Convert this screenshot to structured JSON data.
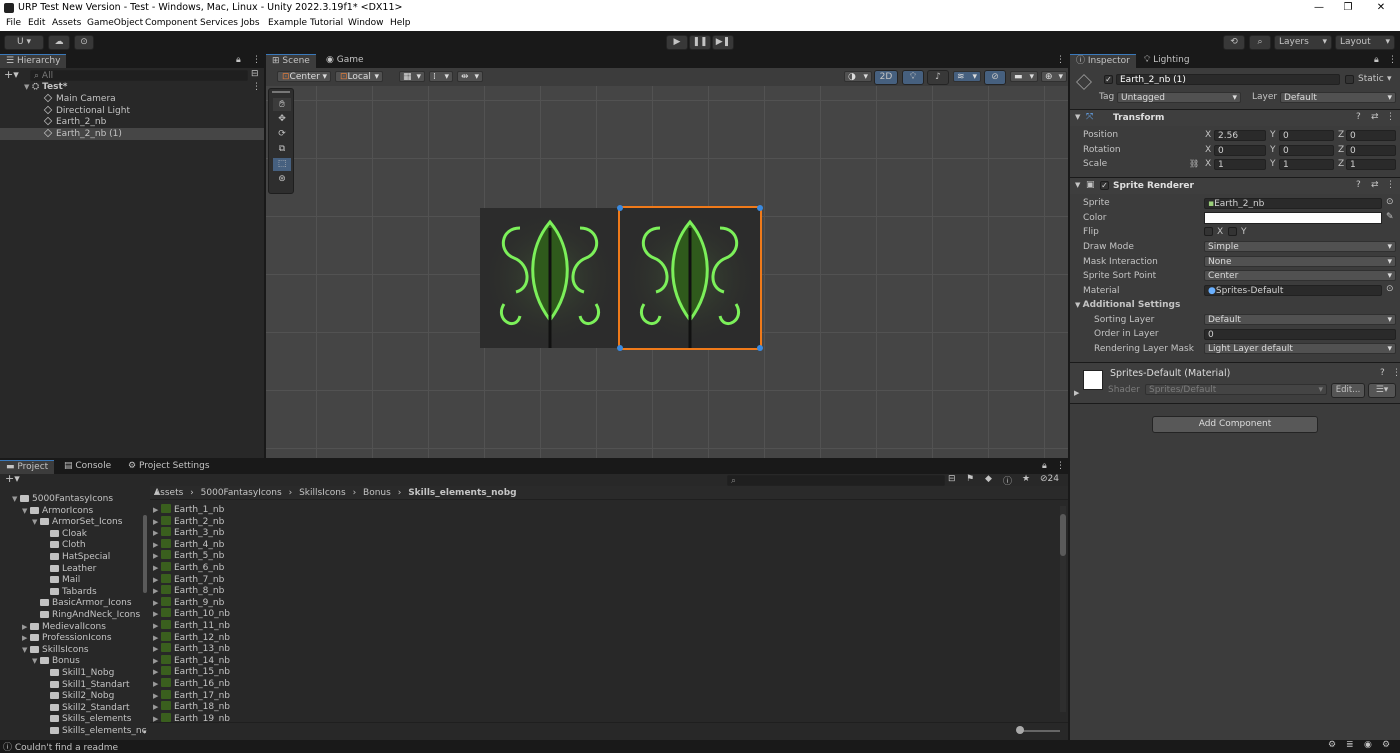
{
  "window": {
    "title": "URP Test New Version - Test - Windows, Mac, Linux - Unity 2022.3.19f1* <DX11>",
    "minimize": "—",
    "maximize": "❐",
    "close": "✕"
  },
  "menu": [
    "File",
    "Edit",
    "Assets",
    "GameObject",
    "Component",
    "Services",
    "Jobs",
    "Example",
    "Tutorial",
    "Window",
    "Help"
  ],
  "toolbar": {
    "account": "U ▾",
    "layers": "Layers",
    "layout": "Layout"
  },
  "hierarchy": {
    "tab": "Hierarchy",
    "search_placeholder": "All",
    "scene": "Test*",
    "items": [
      "Main Camera",
      "Directional Light",
      "Earth_2_nb",
      "Earth_2_nb (1)"
    ]
  },
  "scene_view": {
    "tabs": [
      "Scene",
      "Game"
    ],
    "pivot": "Center",
    "space": "Local",
    "mode2d": "2D"
  },
  "inspector": {
    "tabs": [
      "Inspector",
      "Lighting"
    ],
    "object_name": "Earth_2_nb (1)",
    "static_label": "Static",
    "tag_label": "Tag",
    "tag_value": "Untagged",
    "layer_label": "Layer",
    "layer_value": "Default",
    "transform": {
      "title": "Transform",
      "position_label": "Position",
      "rotation_label": "Rotation",
      "scale_label": "Scale",
      "position": {
        "x": "2.56",
        "y": "0",
        "z": "0"
      },
      "rotation": {
        "x": "0",
        "y": "0",
        "z": "0"
      },
      "scale": {
        "x": "1",
        "y": "1",
        "z": "1"
      }
    },
    "sprite_renderer": {
      "title": "Sprite Renderer",
      "sprite_label": "Sprite",
      "sprite_value": "Earth_2_nb",
      "color_label": "Color",
      "flip_label": "Flip",
      "flip_x": "X",
      "flip_y": "Y",
      "draw_mode_label": "Draw Mode",
      "draw_mode_value": "Simple",
      "mask_label": "Mask Interaction",
      "mask_value": "None",
      "sort_point_label": "Sprite Sort Point",
      "sort_point_value": "Center",
      "material_label": "Material",
      "material_value": "Sprites-Default",
      "additional_label": "Additional Settings",
      "sorting_layer_label": "Sorting Layer",
      "sorting_layer_value": "Default",
      "order_label": "Order in Layer",
      "order_value": "0",
      "rendering_mask_label": "Rendering Layer Mask",
      "rendering_mask_value": "Light Layer default"
    },
    "material": {
      "title": "Sprites-Default (Material)",
      "shader_label": "Shader",
      "shader_value": "Sprites/Default",
      "edit_label": "Edit..."
    },
    "add_component": "Add Component"
  },
  "project": {
    "tabs": [
      "Project",
      "Console",
      "Project Settings"
    ],
    "count": "24",
    "breadcrumb": [
      "Assets",
      "5000FantasyIcons",
      "SkillsIcons",
      "Bonus",
      "Skills_elements_nobg"
    ],
    "tree": [
      {
        "label": "5000FantasyIcons",
        "indent": 0,
        "arrow": "▼"
      },
      {
        "label": "ArmorIcons",
        "indent": 1,
        "arrow": "▼"
      },
      {
        "label": "ArmorSet_Icons",
        "indent": 2,
        "arrow": "▼"
      },
      {
        "label": "Cloak",
        "indent": 3,
        "arrow": ""
      },
      {
        "label": "Cloth",
        "indent": 3,
        "arrow": ""
      },
      {
        "label": "HatSpecial",
        "indent": 3,
        "arrow": ""
      },
      {
        "label": "Leather",
        "indent": 3,
        "arrow": ""
      },
      {
        "label": "Mail",
        "indent": 3,
        "arrow": ""
      },
      {
        "label": "Tabards",
        "indent": 3,
        "arrow": ""
      },
      {
        "label": "BasicArmor_Icons",
        "indent": 2,
        "arrow": ""
      },
      {
        "label": "RingAndNeck_Icons",
        "indent": 2,
        "arrow": ""
      },
      {
        "label": "MedievalIcons",
        "indent": 1,
        "arrow": "▶"
      },
      {
        "label": "ProfessionIcons",
        "indent": 1,
        "arrow": "▶"
      },
      {
        "label": "SkillsIcons",
        "indent": 1,
        "arrow": "▼"
      },
      {
        "label": "Bonus",
        "indent": 2,
        "arrow": "▼"
      },
      {
        "label": "Skill1_Nobg",
        "indent": 3,
        "arrow": ""
      },
      {
        "label": "Skill1_Standart",
        "indent": 3,
        "arrow": ""
      },
      {
        "label": "Skill2_Nobg",
        "indent": 3,
        "arrow": ""
      },
      {
        "label": "Skill2_Standart",
        "indent": 3,
        "arrow": ""
      },
      {
        "label": "Skills_elements",
        "indent": 3,
        "arrow": ""
      },
      {
        "label": "Skills_elements_nc",
        "indent": 3,
        "arrow": ""
      }
    ],
    "assets": [
      "Earth_1_nb",
      "Earth_2_nb",
      "Earth_3_nb",
      "Earth_4_nb",
      "Earth_5_nb",
      "Earth_6_nb",
      "Earth_7_nb",
      "Earth_8_nb",
      "Earth_9_nb",
      "Earth_10_nb",
      "Earth_11_nb",
      "Earth_12_nb",
      "Earth_13_nb",
      "Earth_14_nb",
      "Earth_15_nb",
      "Earth_16_nb",
      "Earth_17_nb",
      "Earth_18_nb",
      "Earth_19_nb"
    ]
  },
  "status": {
    "message": "Couldn't find a readme"
  },
  "colors": {
    "accent": "#3a79bb",
    "selection": "#f07a1a",
    "glow": "#6fe04a"
  }
}
